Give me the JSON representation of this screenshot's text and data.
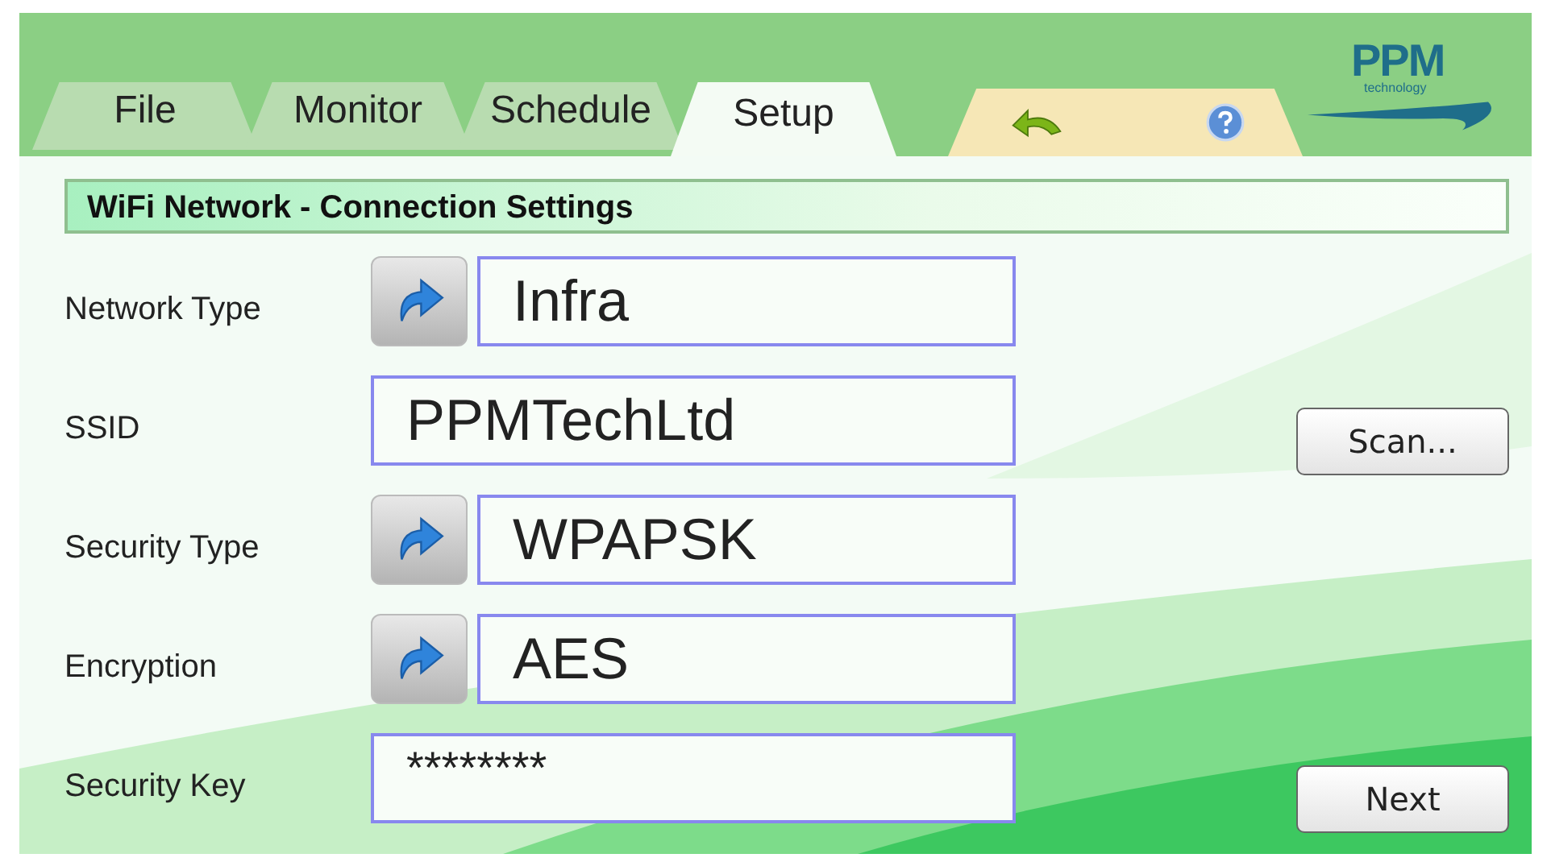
{
  "tabs": [
    {
      "label": "File",
      "selected": false
    },
    {
      "label": "Monitor",
      "selected": false
    },
    {
      "label": "Schedule",
      "selected": false
    },
    {
      "label": "Setup",
      "selected": true
    }
  ],
  "logo": {
    "name": "PPM",
    "tagline": "technology"
  },
  "section_title": "WiFi Network - Connection Settings",
  "fields": [
    {
      "label": "Network Type",
      "kind": "select",
      "value": "Infra"
    },
    {
      "label": "SSID",
      "kind": "text",
      "value": "PPMTechLtd",
      "button": "Scan..."
    },
    {
      "label": "Security Type",
      "kind": "select",
      "value": "WPAPSK"
    },
    {
      "label": "Encryption",
      "kind": "select",
      "value": "AES"
    },
    {
      "label": "Security Key",
      "kind": "password",
      "value": "********",
      "button": "Next"
    }
  ]
}
